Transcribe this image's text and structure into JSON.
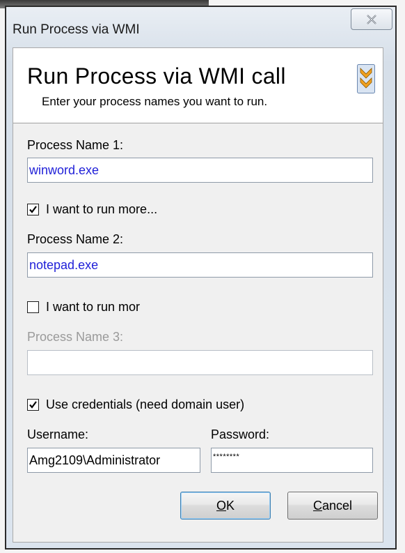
{
  "window": {
    "title": "Run Process via WMI",
    "close_icon": "close-icon"
  },
  "header": {
    "title": "Run Process via WMI call",
    "subtitle": "Enter your process names you want to run.",
    "expand_icon": "double-chevron-icon"
  },
  "process1": {
    "label": "Process Name 1:",
    "value": "winword.exe"
  },
  "more1": {
    "label": "I want to run more...",
    "checked": true
  },
  "process2": {
    "label": "Process Name 2:",
    "value": "notepad.exe"
  },
  "more2": {
    "label": "I want to run mor",
    "checked": false
  },
  "process3": {
    "label": "Process Name 3:",
    "value": "",
    "enabled": false
  },
  "credentials": {
    "label": "Use credentials (need domain user)",
    "checked": true,
    "username_label": "Username:",
    "username_value": "Amg2109\\Administrator",
    "password_label": "Password:",
    "password_value": "********"
  },
  "buttons": {
    "ok_mnemonic": "O",
    "ok_rest": "K",
    "cancel_mnemonic": "C",
    "cancel_rest": "ancel"
  }
}
